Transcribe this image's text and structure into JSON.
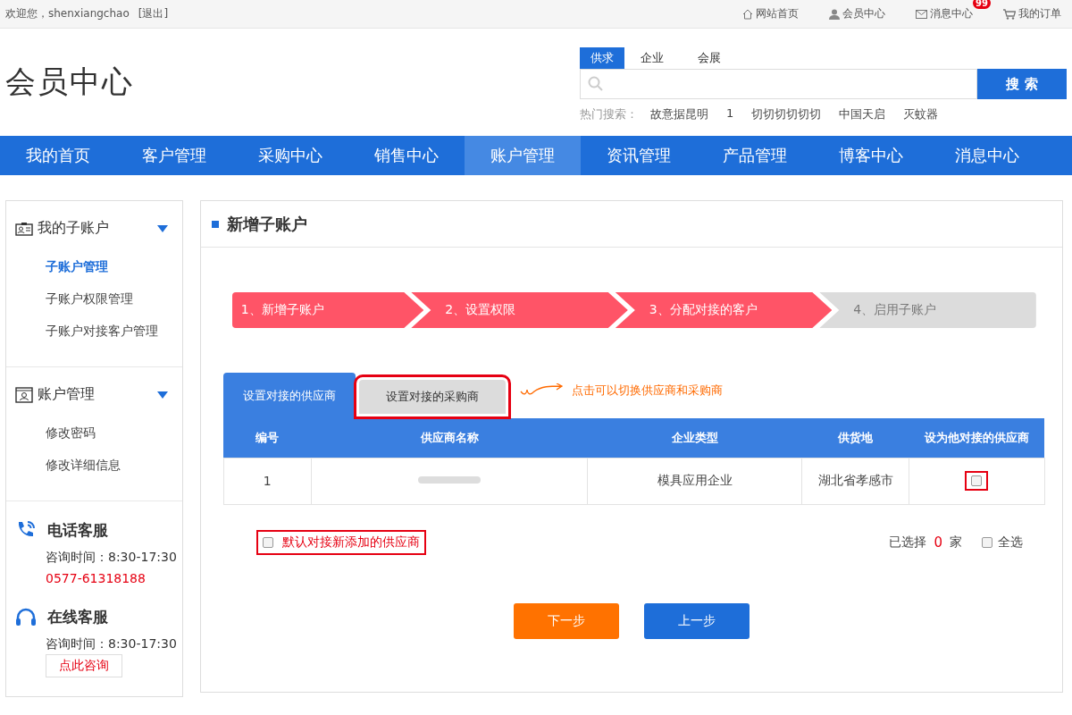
{
  "top_bar": {
    "greeting": "欢迎您，shenxiangchao",
    "logout": "[退出]",
    "links": [
      {
        "kind": "home",
        "label": "网站首页"
      },
      {
        "kind": "user",
        "label": "会员中心"
      },
      {
        "kind": "mail",
        "label": "消息中心",
        "badge": "99"
      },
      {
        "kind": "cart",
        "label": "我的订单"
      }
    ]
  },
  "logo": "会员中心",
  "search": {
    "tabs": [
      {
        "label": "供求",
        "selected": true
      },
      {
        "label": "企业",
        "selected": false
      },
      {
        "label": "会展",
        "selected": false
      }
    ],
    "button": "搜 索",
    "hot_label": "热门搜索：",
    "hot": [
      "故意据昆明",
      "1",
      "切切切切切切",
      "中国天启",
      "灭蚊器"
    ]
  },
  "nav": [
    {
      "label": "我的首页",
      "selected": false
    },
    {
      "label": "客户管理",
      "selected": false
    },
    {
      "label": "采购中心",
      "selected": false
    },
    {
      "label": "销售中心",
      "selected": false
    },
    {
      "label": "账户管理",
      "selected": true
    },
    {
      "label": "资讯管理",
      "selected": false
    },
    {
      "label": "产品管理",
      "selected": false
    },
    {
      "label": "博客中心",
      "selected": false
    },
    {
      "label": "消息中心",
      "selected": false
    }
  ],
  "sidebar": {
    "groups": [
      {
        "kind": "subaccount",
        "title": "我的子账户",
        "expanded": true,
        "items": [
          {
            "label": "子账户管理",
            "selected": true
          },
          {
            "label": "子账户权限管理",
            "selected": false
          },
          {
            "label": "子账户对接客户管理",
            "selected": false
          }
        ]
      },
      {
        "kind": "account",
        "title": "账户管理",
        "expanded": true,
        "items": [
          {
            "label": "修改密码",
            "selected": false
          },
          {
            "label": "修改详细信息",
            "selected": false
          }
        ]
      }
    ],
    "services": [
      {
        "kind": "phone",
        "title": "电话客服",
        "hours": "咨询时间：8:30-17:30",
        "phone": "0577-61318188"
      },
      {
        "kind": "online",
        "title": "在线客服",
        "hours": "咨询时间：8:30-17:30",
        "button": "点此咨询"
      }
    ]
  },
  "main": {
    "title": "新增子账户",
    "steps": [
      {
        "label": "1、新增子账户",
        "done": true
      },
      {
        "label": "2、设置权限",
        "done": true
      },
      {
        "label": "3、分配对接的客户",
        "done": true
      },
      {
        "label": "4、启用子账户",
        "done": false
      }
    ],
    "tabs": [
      {
        "label": "设置对接的供应商",
        "selected": true,
        "highlighted": false
      },
      {
        "label": "设置对接的采购商",
        "selected": false,
        "highlighted": true
      }
    ],
    "hint": "点击可以切换供应商和采购商",
    "table": {
      "columns": [
        "编号",
        "供应商名称",
        "企业类型",
        "供货地",
        "设为他对接的供应商"
      ],
      "rows": [
        {
          "number": "1",
          "type": "模具应用企业",
          "place": "湖北省孝感市",
          "checked": false,
          "highlighted": true
        }
      ]
    },
    "default_option": {
      "label": "默认对接新添加的供应商",
      "checked": false,
      "highlighted": true
    },
    "selected_prefix": "已选择",
    "selected_count": "0",
    "selected_suffix": "家",
    "select_all": {
      "label": "全选",
      "checked": false
    },
    "buttons": [
      {
        "kind": "primary",
        "label": "下一步"
      },
      {
        "kind": "secondary",
        "label": "上一步"
      }
    ]
  }
}
